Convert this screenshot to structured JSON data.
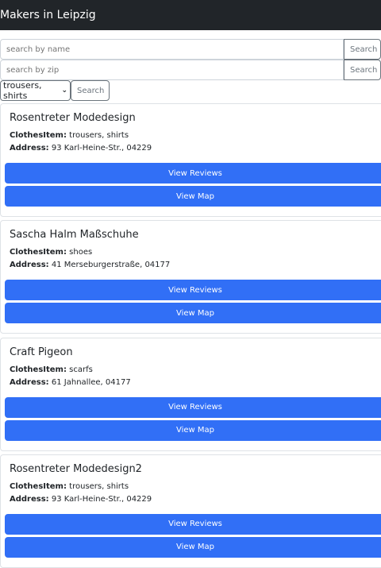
{
  "header": {
    "title": "Makers in Leipzig"
  },
  "search": {
    "name_placeholder": "search by name",
    "zip_placeholder": "search by zip",
    "button": "Search",
    "item_selected": "trousers, shirts"
  },
  "labels": {
    "item": "ClothesItem:",
    "address": "Address:",
    "reviews": "View Reviews",
    "map": "View Map"
  },
  "makers": [
    {
      "name": "Rosentreter Modedesign",
      "item": "trousers, shirts",
      "address": "93 Karl-Heine-Str., 04229"
    },
    {
      "name": "Sascha Halm Maßschuhe",
      "item": "shoes",
      "address": "41 Merseburgerstraße, 04177"
    },
    {
      "name": "Craft Pigeon",
      "item": "scarfs",
      "address": "61 Jahnallee, 04177"
    },
    {
      "name": "Rosentreter Modedesign2",
      "item": "trousers, shirts",
      "address": "93 Karl-Heine-Str., 04229"
    }
  ]
}
